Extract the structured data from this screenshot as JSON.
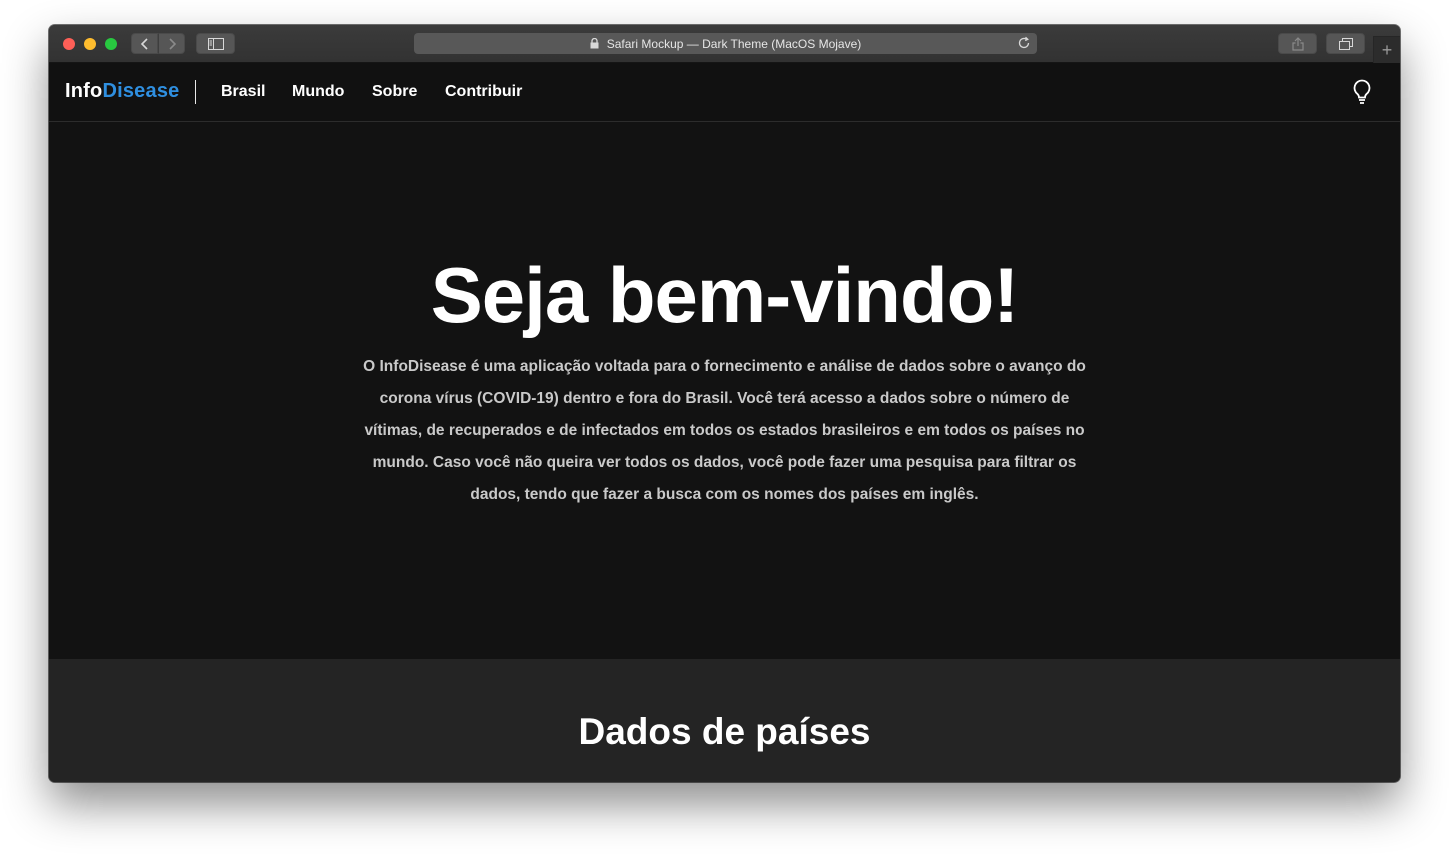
{
  "browser": {
    "address_text": "Safari Mockup — Dark Theme (MacOS Mojave)"
  },
  "site": {
    "brand_prefix": "Info",
    "brand_suffix": "Disease",
    "accent_color": "#2f8fe0",
    "nav": {
      "brasil": "Brasil",
      "mundo": "Mundo",
      "sobre": "Sobre",
      "contribuir": "Contribuir"
    },
    "theme_toggle_icon": "lightbulb-icon"
  },
  "hero": {
    "title": "Seja bem-vindo!",
    "text": "O InfoDisease é uma aplicação voltada para o fornecimento e análise de dados sobre o avanço do corona vírus (COVID-19) dentro e fora do Brasil. Você terá acesso a dados sobre o número de vítimas, de recuperados e de infectados em todos os estados brasileiros e em todos os países no mundo. Caso você não queira ver todos os dados, você pode fazer uma pesquisa para filtrar os dados, tendo que fazer a busca com os nomes dos países em inglês."
  },
  "section": {
    "title": "Dados de países"
  }
}
